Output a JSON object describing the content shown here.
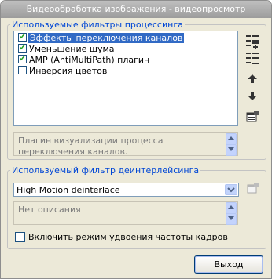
{
  "window": {
    "title": "Видеообработка изображения - видеопросмотр"
  },
  "processing": {
    "legend": "Используемые фильтры процессинга",
    "filters": [
      {
        "label": "Эффекты переключения каналов",
        "checked": true,
        "selected": true
      },
      {
        "label": "Уменьшение шума",
        "checked": true,
        "selected": false
      },
      {
        "label": "AMP (AntiMultiPath) плагин",
        "checked": true,
        "selected": false
      },
      {
        "label": "Инверсия цветов",
        "checked": false,
        "selected": false
      }
    ],
    "description": "Плагин визуализации процесса переключения каналов.",
    "toolbar_icons": [
      "add-filter-icon",
      "remove-filter-icon",
      "move-up-icon",
      "move-down-icon",
      "properties-icon"
    ]
  },
  "deinterlace": {
    "legend": "Используемый фильтр деинтерлейсинга",
    "selected": "High Motion deinterlace",
    "description": "Нет описания",
    "properties_icon": "properties-icon"
  },
  "frame_doubling": {
    "label": "Включить режим удвоения частоты кадров",
    "checked": false
  },
  "buttons": {
    "exit": "Выход"
  }
}
